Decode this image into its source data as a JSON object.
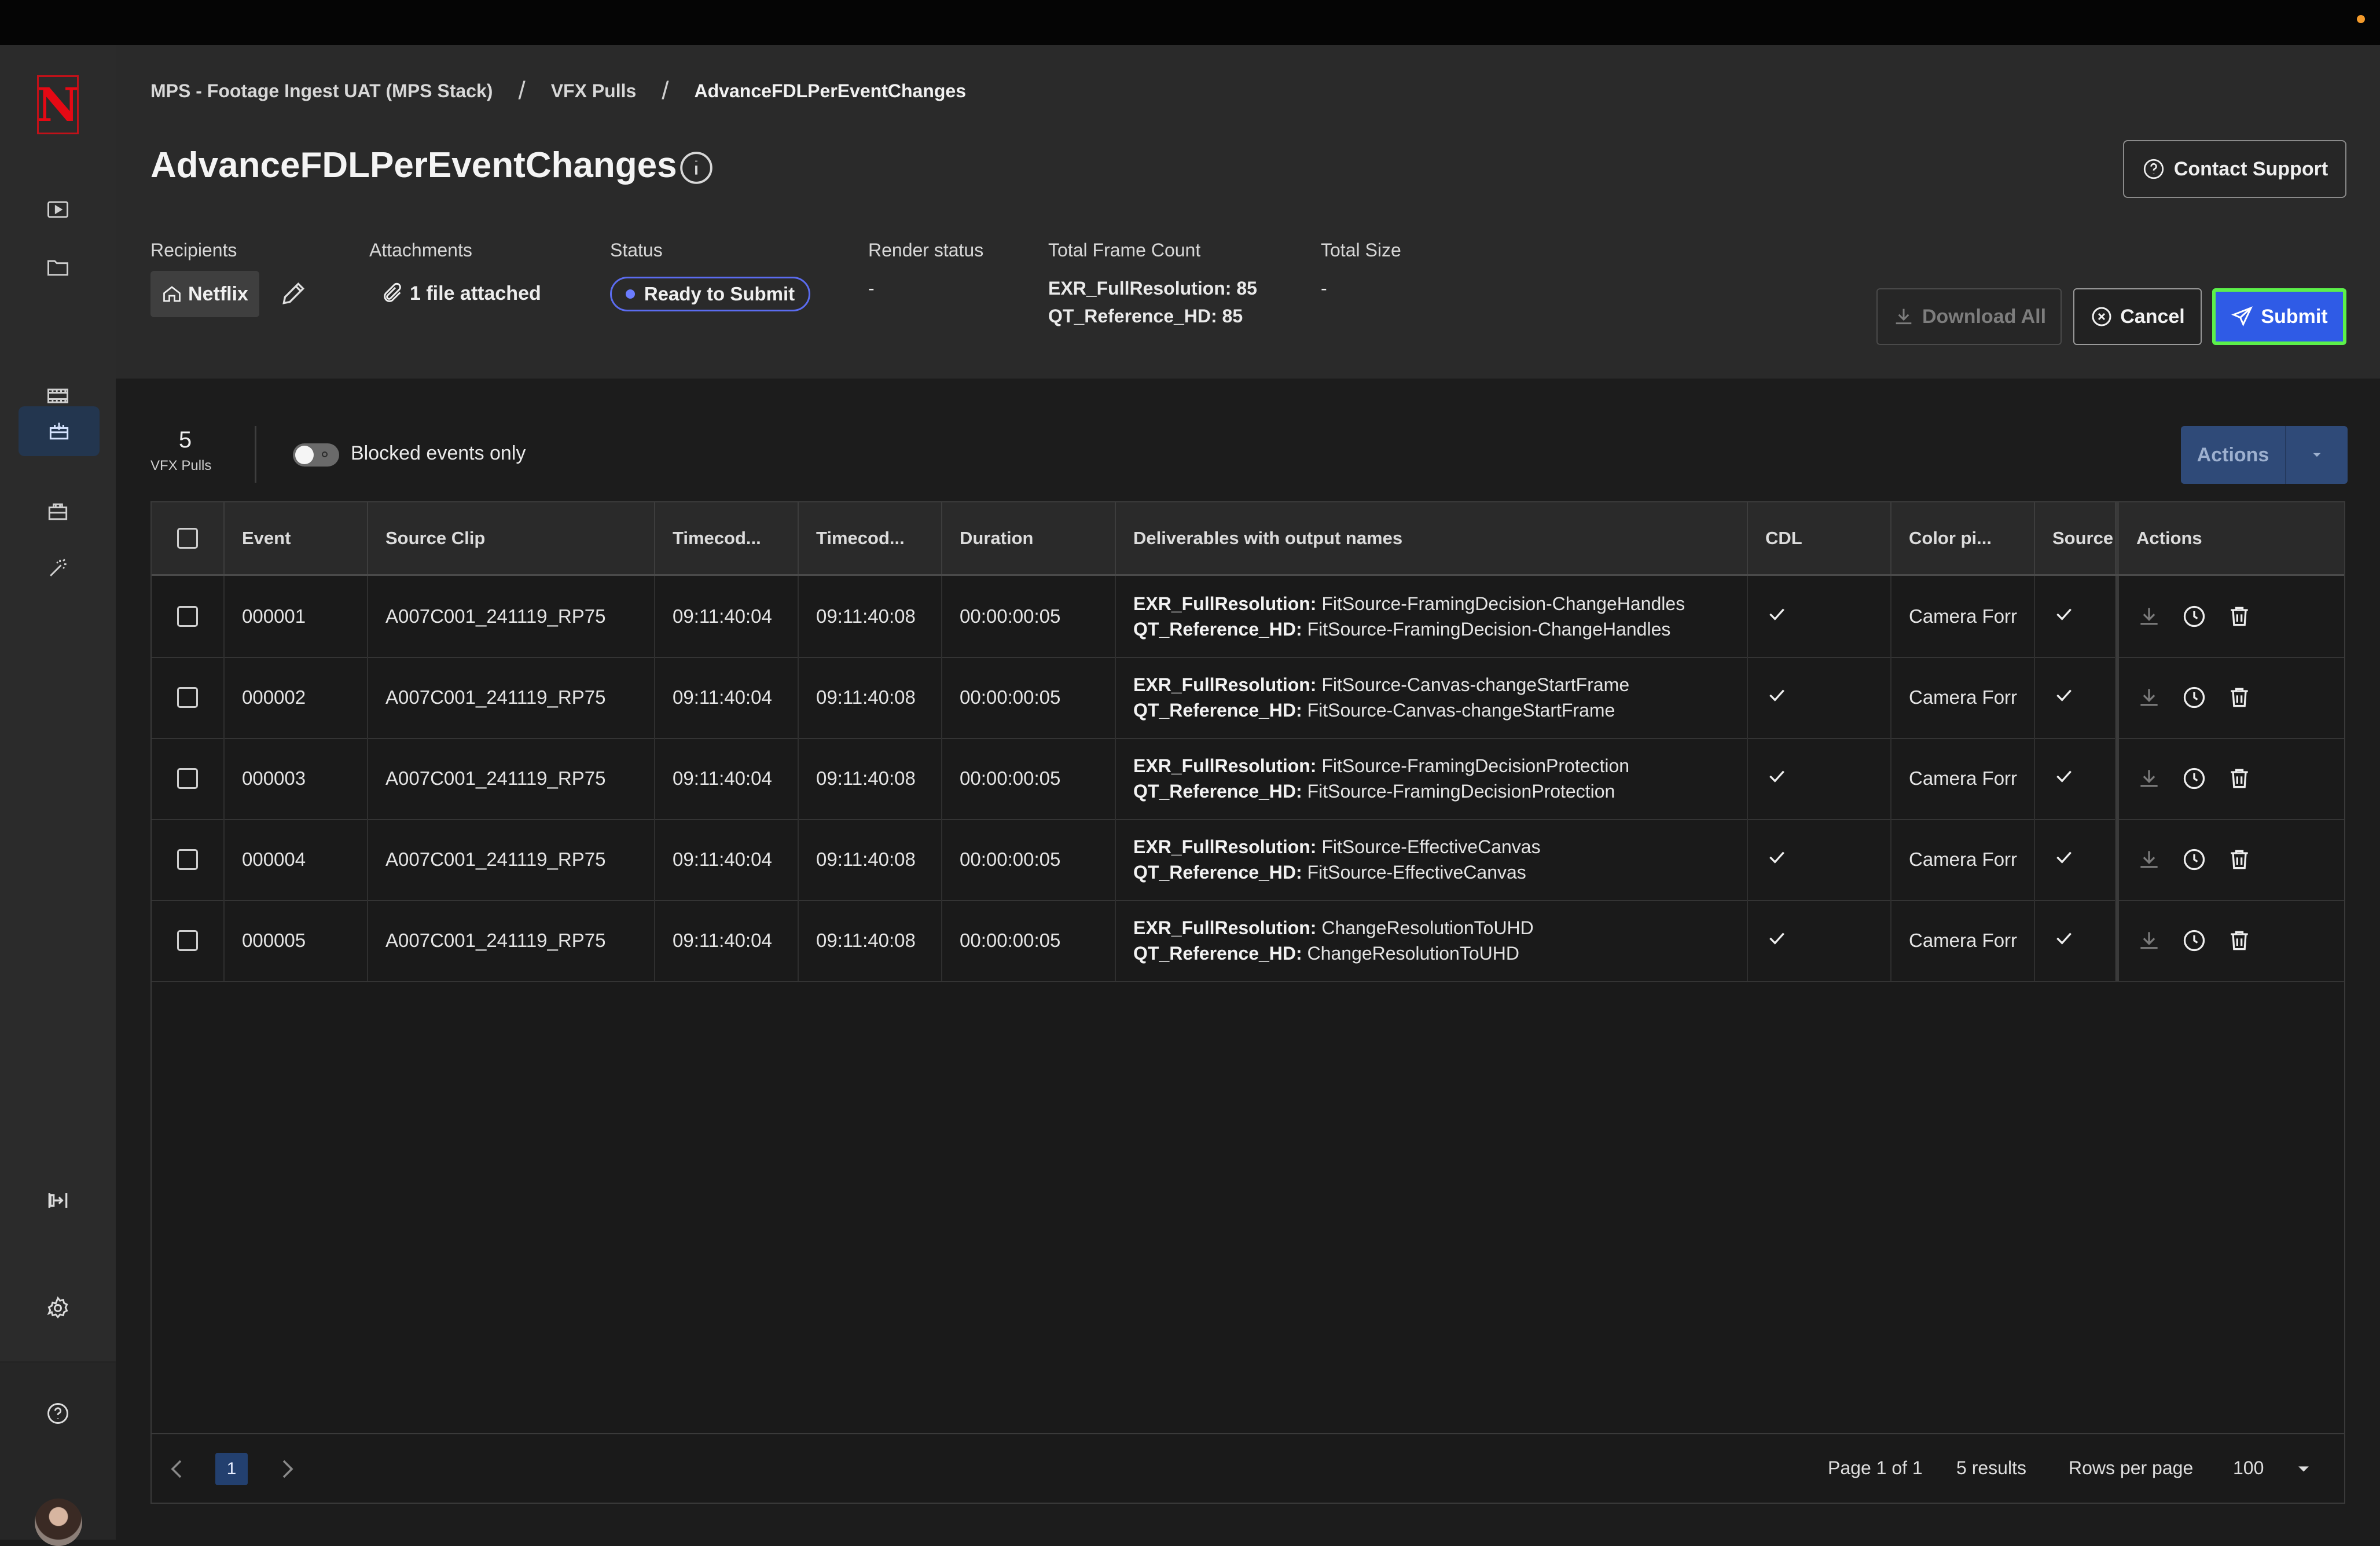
{
  "breadcrumb": [
    "MPS - Footage Ingest UAT (MPS Stack)",
    "VFX Pulls",
    "AdvanceFDLPerEventChanges"
  ],
  "page_title": "AdvanceFDLPerEventChanges",
  "contact_support": "Contact Support",
  "meta": {
    "recipients_label": "Recipients",
    "recipient": "Netflix",
    "attachments_label": "Attachments",
    "attachments_value": "1 file attached",
    "status_label": "Status",
    "status_value": "Ready to Submit",
    "render_status_label": "Render status",
    "render_status_value": "-",
    "frame_count_label": "Total Frame Count",
    "frame_count_lines": [
      "EXR_FullResolution: 85",
      "QT_Reference_HD: 85"
    ],
    "total_size_label": "Total Size",
    "total_size_value": "-"
  },
  "buttons": {
    "download_all": "Download All",
    "cancel": "Cancel",
    "submit": "Submit",
    "actions": "Actions"
  },
  "toolbar": {
    "count": "5",
    "count_label": "VFX Pulls",
    "blocked_only": "Blocked events only",
    "blocked_only_on": false
  },
  "columns": [
    "Event",
    "Source Clip",
    "Timecod...",
    "Timecod...",
    "Duration",
    "Deliverables with output names",
    "CDL",
    "Color pi...",
    "Source",
    "Actions"
  ],
  "rows": [
    {
      "event": "000001",
      "clip": "A007C001_241119_RP75",
      "tc_in": "09:11:40:04",
      "tc_out": "09:11:40:08",
      "duration": "00:00:00:05",
      "d1_key": "EXR_FullResolution:",
      "d1_val": " FitSource-FramingDecision-ChangeHandles",
      "d2_key": "QT_Reference_HD:",
      "d2_val": " FitSource-FramingDecision-ChangeHandles",
      "color": "Camera Forr"
    },
    {
      "event": "000002",
      "clip": "A007C001_241119_RP75",
      "tc_in": "09:11:40:04",
      "tc_out": "09:11:40:08",
      "duration": "00:00:00:05",
      "d1_key": "EXR_FullResolution:",
      "d1_val": " FitSource-Canvas-changeStartFrame",
      "d2_key": "QT_Reference_HD:",
      "d2_val": " FitSource-Canvas-changeStartFrame",
      "color": "Camera Forr"
    },
    {
      "event": "000003",
      "clip": "A007C001_241119_RP75",
      "tc_in": "09:11:40:04",
      "tc_out": "09:11:40:08",
      "duration": "00:00:00:05",
      "d1_key": "EXR_FullResolution:",
      "d1_val": " FitSource-FramingDecisionProtection",
      "d2_key": "QT_Reference_HD:",
      "d2_val": " FitSource-FramingDecisionProtection",
      "color": "Camera Forr"
    },
    {
      "event": "000004",
      "clip": "A007C001_241119_RP75",
      "tc_in": "09:11:40:04",
      "tc_out": "09:11:40:08",
      "duration": "00:00:00:05",
      "d1_key": "EXR_FullResolution:",
      "d1_val": " FitSource-EffectiveCanvas",
      "d2_key": "QT_Reference_HD:",
      "d2_val": " FitSource-EffectiveCanvas",
      "color": "Camera Forr"
    },
    {
      "event": "000005",
      "clip": "A007C001_241119_RP75",
      "tc_in": "09:11:40:04",
      "tc_out": "09:11:40:08",
      "duration": "00:00:00:05",
      "d1_key": "EXR_FullResolution:",
      "d1_val": " ChangeResolutionToUHD",
      "d2_key": "QT_Reference_HD:",
      "d2_val": " ChangeResolutionToUHD",
      "color": "Camera Forr"
    }
  ],
  "pagination": {
    "current_page": "1",
    "page_of": "Page 1 of 1",
    "results": "5 results",
    "rows_per_page_label": "Rows per page",
    "rows_per_page": "100"
  },
  "icons": {
    "sidebar": [
      "netflix-logo",
      "play-icon",
      "folder-icon",
      "film-icon",
      "vfx-pulls-icon",
      "camera-bag-icon",
      "magic-wand-icon",
      "collapse-sidebar-icon",
      "settings-icon",
      "help-icon"
    ],
    "row_actions": [
      "download-icon",
      "history-icon",
      "delete-icon"
    ]
  },
  "colors": {
    "accent": "#2f5be6",
    "submit_highlight": "#5cf04a",
    "status_outline": "#5b6cf0",
    "brand": "#e50914"
  }
}
